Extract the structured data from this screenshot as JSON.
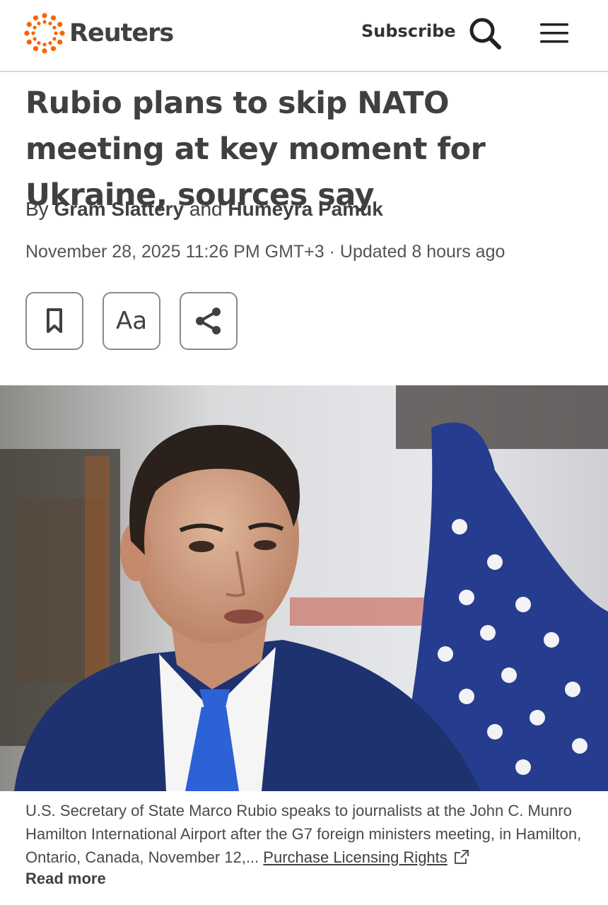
{
  "header": {
    "brand": "Reuters",
    "subscribe_label": "Subscribe",
    "accent_color": "#fa6400"
  },
  "article": {
    "headline": "Rubio plans to skip NATO meeting at key moment for Ukraine, sources say",
    "byline": {
      "prefix": "By",
      "author_1": "Gram Slattery",
      "conjunction": "and",
      "author_2": "Humeyra Pamuk"
    },
    "dateline": "November 28, 2025 11:26 PM GMT+3 · Updated 8 hours ago",
    "tools": {
      "font_size_label": "Aa"
    },
    "photo": {
      "caption": "U.S. Secretary of State Marco Rubio speaks to journalists at the John C. Munro Hamilton International Airport after the G7 foreign ministers meeting, in Hamilton, Ontario, Canada, November 12,...",
      "license_link": "Purchase Licensing Rights",
      "read_more": "Read more"
    }
  }
}
